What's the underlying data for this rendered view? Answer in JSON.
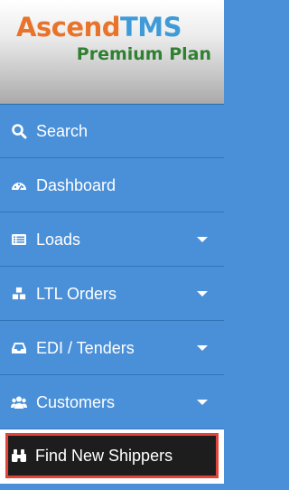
{
  "brand": {
    "name_part1": "Ascend",
    "name_part2": "TMS",
    "plan": "Premium Plan",
    "colors": {
      "part1": "#e8732a",
      "part2": "#3f9bd8",
      "plan": "#2f8030"
    }
  },
  "nav": {
    "items": [
      {
        "label": "Search",
        "icon": "search-icon",
        "has_dropdown": false
      },
      {
        "label": "Dashboard",
        "icon": "dashboard-icon",
        "has_dropdown": false
      },
      {
        "label": "Loads",
        "icon": "list-icon",
        "has_dropdown": true
      },
      {
        "label": "LTL Orders",
        "icon": "cubes-icon",
        "has_dropdown": true
      },
      {
        "label": "EDI / Tenders",
        "icon": "inbox-icon",
        "has_dropdown": true
      },
      {
        "label": "Customers",
        "icon": "users-icon",
        "has_dropdown": true
      },
      {
        "label": "Find New Shippers",
        "icon": "binoculars-icon",
        "has_dropdown": false,
        "highlighted": true
      }
    ]
  },
  "colors": {
    "sidebar_bg": "#4a90d9",
    "highlight_item_bg": "#1d1d1d",
    "highlight_border": "#e0453a"
  }
}
